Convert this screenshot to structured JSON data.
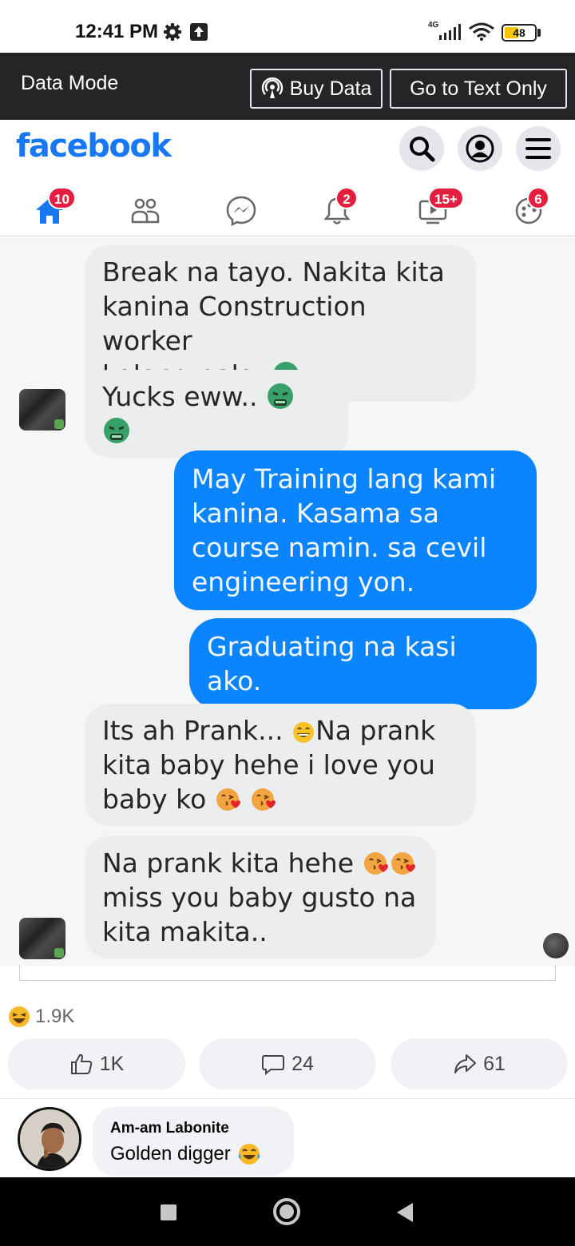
{
  "status_bar": {
    "time": "12:41 PM",
    "network": "4G",
    "battery": "48",
    "battery_level": 0.48
  },
  "data_banner": {
    "label": "Data Mode",
    "buy_data": "Buy Data",
    "text_only": "Go to Text Only"
  },
  "header": {
    "logo": "facebook",
    "brand_color": "#1877f2"
  },
  "nav": {
    "home_badge": "10",
    "notifications_badge": "2",
    "video_badge": "15+",
    "gaming_badge": "6",
    "icons": [
      "home-icon",
      "friends-icon",
      "messenger-icon",
      "bell-icon",
      "video-icon",
      "gaming-icon"
    ]
  },
  "conversation": {
    "msg1": [
      "Break na tayo. Nakita kita",
      "kanina Construction worker",
      "kalang pala."
    ],
    "msg2": "Yucks eww..",
    "msg3": [
      "May Training lang kami",
      "kanina. Kasama sa",
      "course namin. sa cevil",
      "engineering yon."
    ],
    "msg4": "Graduating na kasi ako.",
    "msg5a": "Its ah Prank...",
    "msg5b": "Na prank",
    "msg5c": "kita baby hehe i love you",
    "msg5d": "baby ko",
    "msg6a": "Na prank kita hehe",
    "msg6b": "miss you baby gusto na",
    "msg6c": "kita makita.."
  },
  "post": {
    "reactions": "1.9K",
    "likes": "1K",
    "comments": "24",
    "shares": "61"
  },
  "comment": {
    "author": "Am-am Labonite",
    "text": "Golden digger"
  }
}
